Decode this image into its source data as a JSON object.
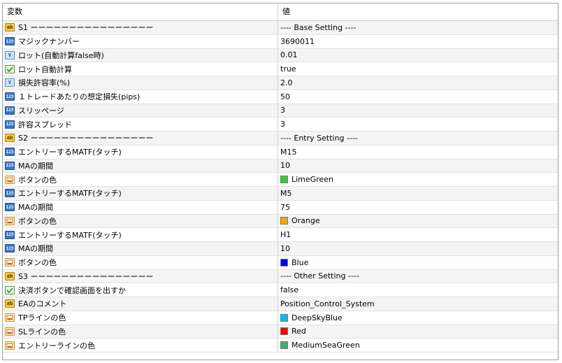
{
  "header": {
    "variable_col": "変数",
    "value_col": "値"
  },
  "rows": [
    {
      "icon": "ab",
      "name": "S1 ーーーーーーーーーーーーーーーー",
      "value": "---- Base Setting ----"
    },
    {
      "icon": "123",
      "name": "マジックナンバー",
      "value": "3690011"
    },
    {
      "icon": "vd",
      "name": "ロット(自動計算false時)",
      "value": "0.01"
    },
    {
      "icon": "bool",
      "name": "ロット自動計算",
      "value": "true"
    },
    {
      "icon": "vd",
      "name": "損失許容率(%)",
      "value": "2.0"
    },
    {
      "icon": "123",
      "name": "１トレードあたりの想定損失(pips)",
      "value": "50"
    },
    {
      "icon": "123",
      "name": "スリッページ",
      "value": "3"
    },
    {
      "icon": "123",
      "name": "許容スプレッド",
      "value": "3"
    },
    {
      "icon": "ab",
      "name": "S2 ーーーーーーーーーーーーーーーー",
      "value": "---- Entry Setting ----"
    },
    {
      "icon": "123",
      "name": "エントリーするMATF(タッチ)",
      "value": "M15"
    },
    {
      "icon": "123",
      "name": "MAの期間",
      "value": "10"
    },
    {
      "icon": "col",
      "name": "ボタンの色",
      "value": "LimeGreen",
      "color": "#32cd32"
    },
    {
      "icon": "123",
      "name": "エントリーするMATF(タッチ)",
      "value": "M5"
    },
    {
      "icon": "123",
      "name": "MAの期間",
      "value": "75"
    },
    {
      "icon": "col",
      "name": "ボタンの色",
      "value": "Orange",
      "color": "#ffa500"
    },
    {
      "icon": "123",
      "name": "エントリーするMATF(タッチ)",
      "value": "H1"
    },
    {
      "icon": "123",
      "name": "MAの期間",
      "value": "10"
    },
    {
      "icon": "col",
      "name": "ボタンの色",
      "value": "Blue",
      "color": "#0000ff"
    },
    {
      "icon": "ab",
      "name": "S3 ーーーーーーーーーーーーーーーー",
      "value": "---- Other Setting ----"
    },
    {
      "icon": "bool",
      "name": "決済ボタンで確認画面を出すか",
      "value": "false"
    },
    {
      "icon": "ab",
      "name": "EAのコメント",
      "value": "Position_Control_System"
    },
    {
      "icon": "col",
      "name": "TPラインの色",
      "value": "DeepSkyBlue",
      "color": "#00bfff"
    },
    {
      "icon": "col",
      "name": "SLラインの色",
      "value": "Red",
      "color": "#ff0000"
    },
    {
      "icon": "col",
      "name": "エントリーラインの色",
      "value": "MediumSeaGreen",
      "color": "#3cb371"
    }
  ]
}
